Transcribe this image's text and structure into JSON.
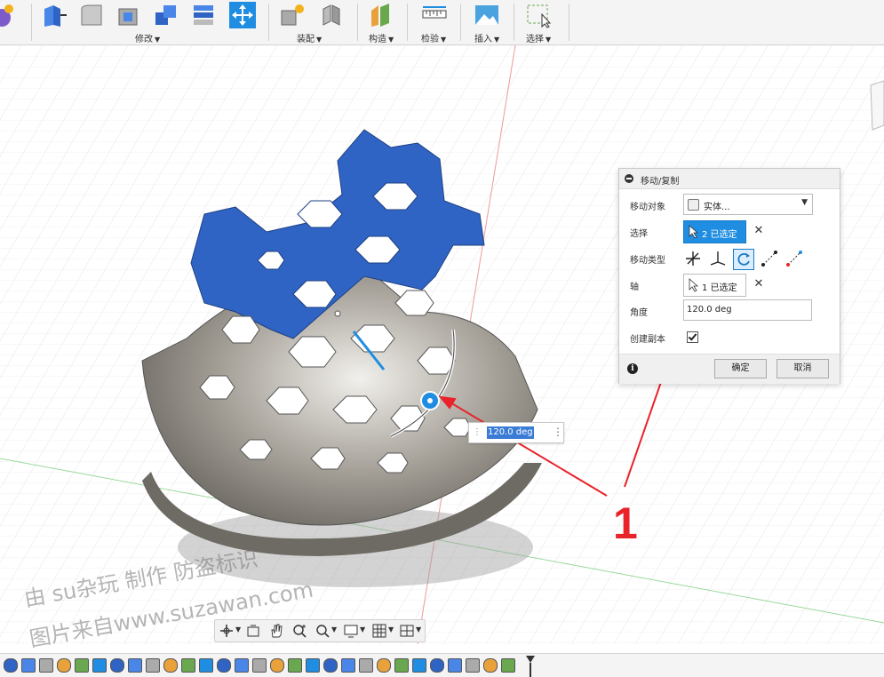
{
  "ribbon": {
    "groups": [
      {
        "label": "修改",
        "id": "modify"
      },
      {
        "label": "装配",
        "id": "assemble"
      },
      {
        "label": "构造",
        "id": "construct"
      },
      {
        "label": "检验",
        "id": "inspect"
      },
      {
        "label": "插入",
        "id": "insert"
      },
      {
        "label": "选择",
        "id": "select"
      }
    ]
  },
  "floating_input": {
    "value": "120.0 deg"
  },
  "dialog": {
    "title": "移动/复制",
    "rows": {
      "object_label": "移动对象",
      "object_value": "实体...",
      "selection_label": "选择",
      "selection_value": "2 已选定",
      "move_type_label": "移动类型",
      "axis_label": "轴",
      "axis_value": "1 已选定",
      "angle_label": "角度",
      "angle_value": "120.0 deg",
      "copy_label": "创建副本",
      "copy_checked": true
    },
    "ok": "确定",
    "cancel": "取消"
  },
  "watermark": {
    "line1": "由 su杂玩 制作 防盗标识",
    "line2": "图片来自www.suzawan.com"
  },
  "callout": "1",
  "colors": {
    "accent": "#1f8de1",
    "selected_body": "#2f64c4",
    "callout_red": "#e8232a"
  }
}
